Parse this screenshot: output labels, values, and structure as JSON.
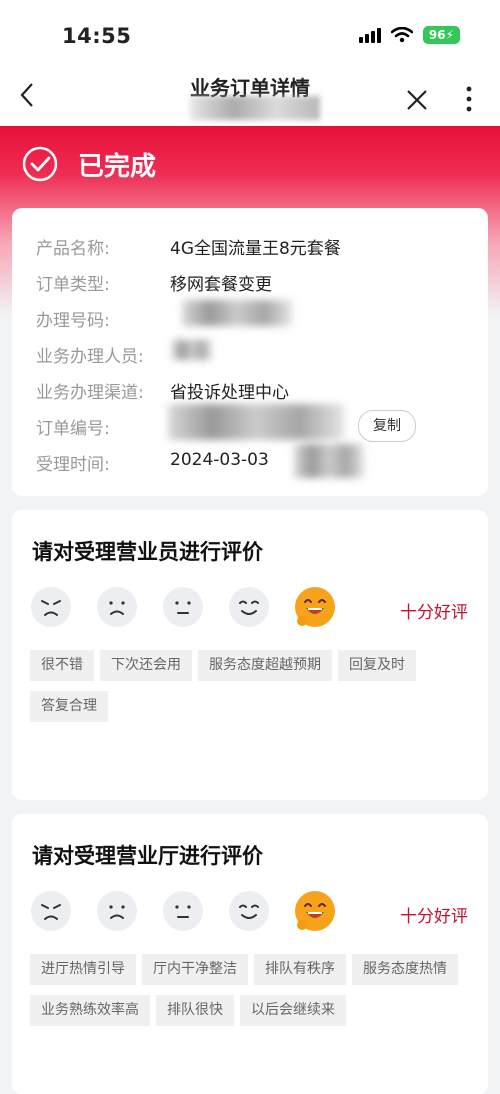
{
  "status": {
    "time": "14:55",
    "battery": "96"
  },
  "nav": {
    "title": "业务订单详情"
  },
  "banner": {
    "status_text": "已完成"
  },
  "order": {
    "rows": [
      {
        "label": "产品名称:",
        "value": "4G全国流量王8元套餐"
      },
      {
        "label": "订单类型:",
        "value": "移网套餐变更"
      },
      {
        "label": "办理号码:",
        "value": ""
      },
      {
        "label": "业务办理人员:",
        "value": ""
      },
      {
        "label": "业务办理渠道:",
        "value": "省投诉处理中心"
      },
      {
        "label": "订单编号:",
        "value": ""
      },
      {
        "label": "受理时间:",
        "value": "2024-03-03"
      }
    ],
    "copy_label": "复制"
  },
  "rating_staff": {
    "title": "请对受理营业员进行评价",
    "selected_label": "十分好评",
    "selected_index": 4,
    "tags": [
      "很不错",
      "下次还会用",
      "服务态度超越预期",
      "回复及时",
      "答复合理"
    ]
  },
  "rating_hall": {
    "title": "请对受理营业厅进行评价",
    "selected_label": "十分好评",
    "selected_index": 4,
    "tags": [
      "进厅热情引导",
      "厅内干净整洁",
      "排队有秩序",
      "服务态度热情",
      "业务熟练效率高",
      "排队很快",
      "以后会继续来"
    ]
  },
  "faces": [
    "angry-face-icon",
    "sad-face-icon",
    "neutral-face-icon",
    "smile-face-icon",
    "laughing-face-icon"
  ],
  "colors": {
    "accent": "#e8103a",
    "rating_text": "#c8102e",
    "selected_face": "#f7a21b"
  }
}
